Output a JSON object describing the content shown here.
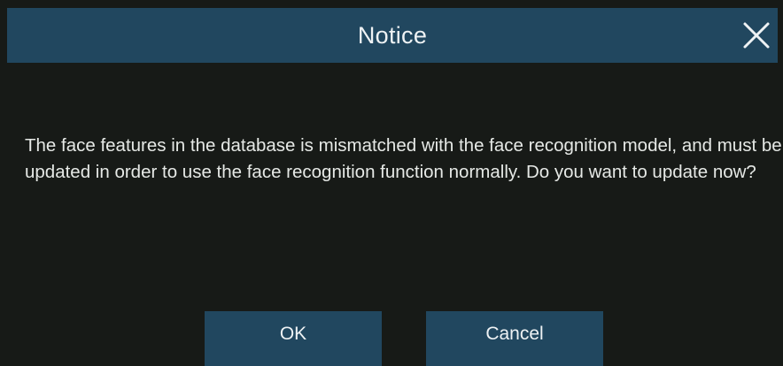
{
  "dialog": {
    "title": "Notice",
    "close_icon": "close-icon",
    "message": "The face features in the database is mismatched with the face recognition model, and must be updated in order to use the face recognition function normally. Do you want to update now?",
    "ok_label": "OK",
    "cancel_label": "Cancel"
  },
  "colors": {
    "background": "#171a17",
    "title_bar": "#21475f",
    "button": "#21475f",
    "text": "#e8ebe8"
  }
}
